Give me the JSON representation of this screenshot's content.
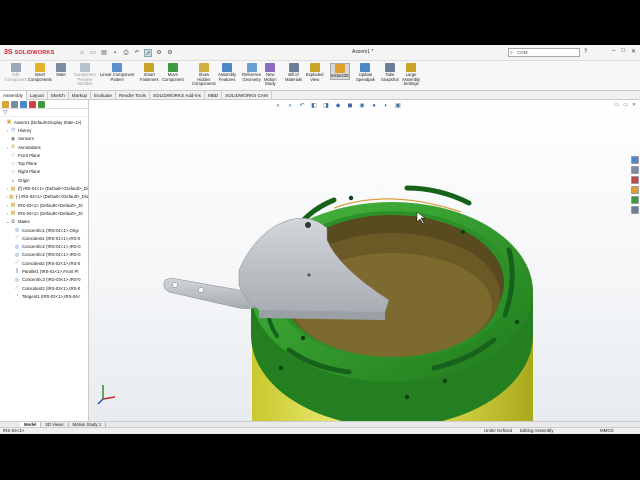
{
  "app": {
    "brand": "SOLIDWORKS",
    "doc_title": "Assem1 *",
    "search_placeholder": "COM"
  },
  "commands": [
    {
      "label": "Edit\nComponent",
      "disabled": true,
      "color": "#9aa8b8"
    },
    {
      "label": "Insert\nComponents",
      "disabled": false,
      "color": "#e3b32c"
    },
    {
      "label": "Mate",
      "disabled": false,
      "color": "#7a8ca0"
    },
    {
      "label": "Component\nPreview\nWindow",
      "disabled": true,
      "color": "#b7c2cf"
    },
    {
      "label": "Linear Component\nPattern",
      "disabled": false,
      "color": "#5a8fd0"
    },
    {
      "label": "Smart\nFasteners",
      "disabled": false,
      "color": "#c9a227"
    },
    {
      "label": "Move\nComponent",
      "disabled": false,
      "color": "#3f9a3f"
    },
    {
      "label": "Show\nHidden\nComponents",
      "disabled": false,
      "color": "#d0b040"
    },
    {
      "label": "Assembly\nFeatures",
      "disabled": false,
      "color": "#4d88c8"
    },
    {
      "label": "Reference\nGeometry",
      "disabled": false,
      "color": "#6aa0d8"
    },
    {
      "label": "New\nMotion\nStudy",
      "disabled": false,
      "color": "#8a6bbf"
    },
    {
      "label": "Bill of\nMaterials",
      "disabled": false,
      "color": "#6a7f96"
    },
    {
      "label": "Exploded\nView",
      "disabled": false,
      "color": "#c9a227"
    },
    {
      "label": "Instant3D",
      "disabled": false,
      "color": "#e0a030",
      "selected": true
    },
    {
      "label": "Update\nSpeedpak",
      "disabled": false,
      "color": "#4d88c8"
    },
    {
      "label": "Take\nSnapshot",
      "disabled": false,
      "color": "#6a7f96"
    },
    {
      "label": "Large\nAssembly\nSettings",
      "disabled": false,
      "color": "#c9a227"
    }
  ],
  "tabs": [
    "Assembly",
    "Layout",
    "Sketch",
    "Markup",
    "Evaluate",
    "Render Tools",
    "SOLIDWORKS Add-Ins",
    "MBD",
    "SOLIDWORKS CAM"
  ],
  "tree": [
    {
      "label": "Assem1 (Default<Display State-1>)",
      "arrow": "",
      "icon": "asm",
      "indent": 0
    },
    {
      "label": "History",
      "arrow": "›",
      "icon": "hist",
      "indent": 1
    },
    {
      "label": "Sensors",
      "arrow": "",
      "icon": "sens",
      "indent": 1
    },
    {
      "label": "Annotations",
      "arrow": "›",
      "icon": "anno",
      "indent": 1
    },
    {
      "label": "Front Plane",
      "arrow": "",
      "icon": "plane",
      "indent": 1
    },
    {
      "label": "Top Plane",
      "arrow": "",
      "icon": "plane",
      "indent": 1
    },
    {
      "label": "Right Plane",
      "arrow": "",
      "icon": "plane",
      "indent": 1
    },
    {
      "label": "Origin",
      "arrow": "",
      "icon": "origin",
      "indent": 1
    },
    {
      "label": "(f) IRS-01<1> (Default<<Default>_Di",
      "arrow": "›",
      "icon": "part",
      "indent": 1
    },
    {
      "label": "(-) IRS-02<1> (Default<<Default>_Dis",
      "arrow": "›",
      "icon": "part",
      "indent": 1
    },
    {
      "label": "IRS-03<1> (Default<<Default>_Di",
      "arrow": "›",
      "icon": "part",
      "indent": 1
    },
    {
      "label": "IRS-04<1> (Default<<Default>_Di",
      "arrow": "›",
      "icon": "part",
      "indent": 1
    },
    {
      "label": "Mates",
      "arrow": "⌄",
      "icon": "mates",
      "indent": 1
    },
    {
      "label": "Concentric1 (IRS-01<1>,Origi",
      "arrow": "",
      "icon": "conc",
      "indent": 2
    },
    {
      "label": "Coincident1 (IRS-01<1>,IRS-0",
      "arrow": "",
      "icon": "coin",
      "indent": 2
    },
    {
      "label": "Concentric2 (IRS-01<1>,IRS-0",
      "arrow": "",
      "icon": "conc",
      "indent": 2
    },
    {
      "label": "Concentric2 (IRS-01<1>,IRS-0",
      "arrow": "",
      "icon": "conc",
      "indent": 2
    },
    {
      "label": "Coincident2 (IRS-02<1>,IRS-0",
      "arrow": "",
      "icon": "coin",
      "indent": 2
    },
    {
      "label": "Parallel1 (IRS-01<1>,Front Pl",
      "arrow": "",
      "icon": "par",
      "indent": 2
    },
    {
      "label": "Concentric3 (IRS-03<1>,IRS-0",
      "arrow": "",
      "icon": "conc",
      "indent": 2
    },
    {
      "label": "Coincident3 (IRS-03<1>,IRS-0",
      "arrow": "",
      "icon": "coin",
      "indent": 2
    },
    {
      "label": "Tangent1 (IRS-02<1>,IRS-04<",
      "arrow": "",
      "icon": "tan",
      "indent": 2
    }
  ],
  "bottom_tabs": [
    "Model",
    "3D Views",
    "Motion Study 1"
  ],
  "status": {
    "left": "IRS-04<1>",
    "state": "Under Defined",
    "mode": "Editing Assembly",
    "units": "MMGS"
  },
  "colors": {
    "green_part": "#2f9a2a",
    "yellow_housing": "#d8d84a",
    "grey_part": "#b9bdc2",
    "brand_red": "#d21e2b"
  }
}
